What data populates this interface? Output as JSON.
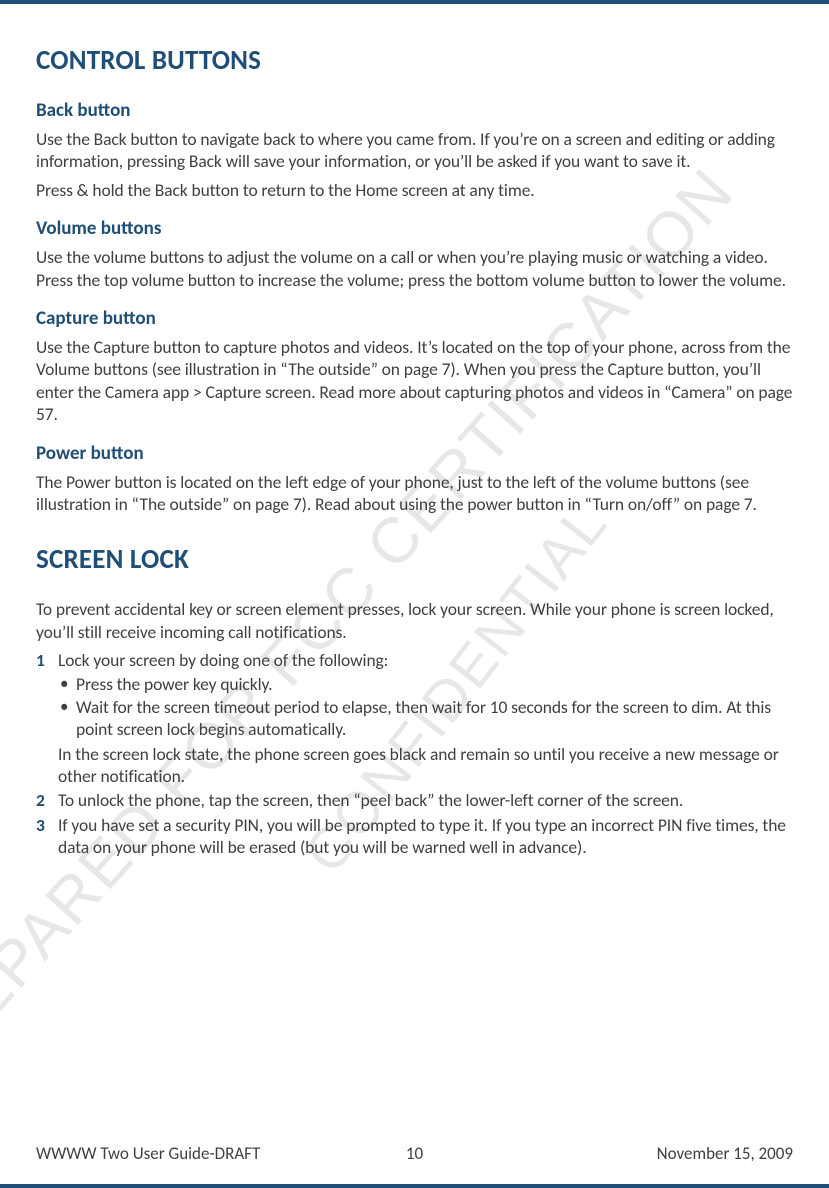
{
  "watermarks": {
    "wm1": "PREPARED FOR FCC CERTIFICATION",
    "wm2": "CONFIDENTIAL"
  },
  "section1": {
    "title": "CONTROL BUTTONS",
    "back": {
      "heading": "Back button",
      "p1": "Use the Back button to navigate back to where you came from. If you’re on a screen and editing or adding information, pressing Back will save your information, or you’ll be asked if you want to save it.",
      "p2": "Press & hold the Back button to return to the Home screen at any time."
    },
    "volume": {
      "heading": "Volume buttons",
      "p1": "Use the volume buttons to adjust the volume on a call or when you’re playing music or watching a video. Press the top volume button to increase the volume; press the bottom volume button to lower the volume."
    },
    "capture": {
      "heading": "Capture button",
      "p1": "Use the Capture button to capture photos and videos. It’s located on the top of your phone, across from the Volume buttons (see illustration in “The outside” on page 7). When you press the Capture button, you’ll enter the Camera app > Capture screen. Read more about capturing photos and videos in “Camera” on page 57."
    },
    "power": {
      "heading": "Power button",
      "p1": "The Power button is located on the left edge of your phone, just to the left of the volume buttons (see illustration in “The outside” on page 7). Read about using the power button in “Turn on/off” on page 7."
    }
  },
  "section2": {
    "title": "SCREEN LOCK",
    "intro": "To prevent accidental key or screen element presses, lock your screen. While your phone is screen locked, you’ll still receive incoming call notifications.",
    "steps": {
      "s1": {
        "num": "1",
        "lead": "Lock your screen by doing one of the following:",
        "b1": "Press the power key quickly.",
        "b2": "Wait for the screen timeout period to elapse, then wait for 10 seconds for the screen to dim. At this point screen lock begins automatically.",
        "after": "In the screen lock state, the phone screen goes black and remain so until you receive a new message or other notification."
      },
      "s2": {
        "num": "2",
        "text": "To unlock the phone, tap the screen, then “peel back” the lower-left corner of the screen."
      },
      "s3": {
        "num": "3",
        "text": "If you have set a security PIN, you will be prompted to type it. If you type an incorrect PIN five times, the data on your phone will be erased (but you will be warned well in advance)."
      }
    }
  },
  "footer": {
    "left": "WWWW Two User Guide-DRAFT",
    "center": "10",
    "right": "November 15, 2009"
  }
}
